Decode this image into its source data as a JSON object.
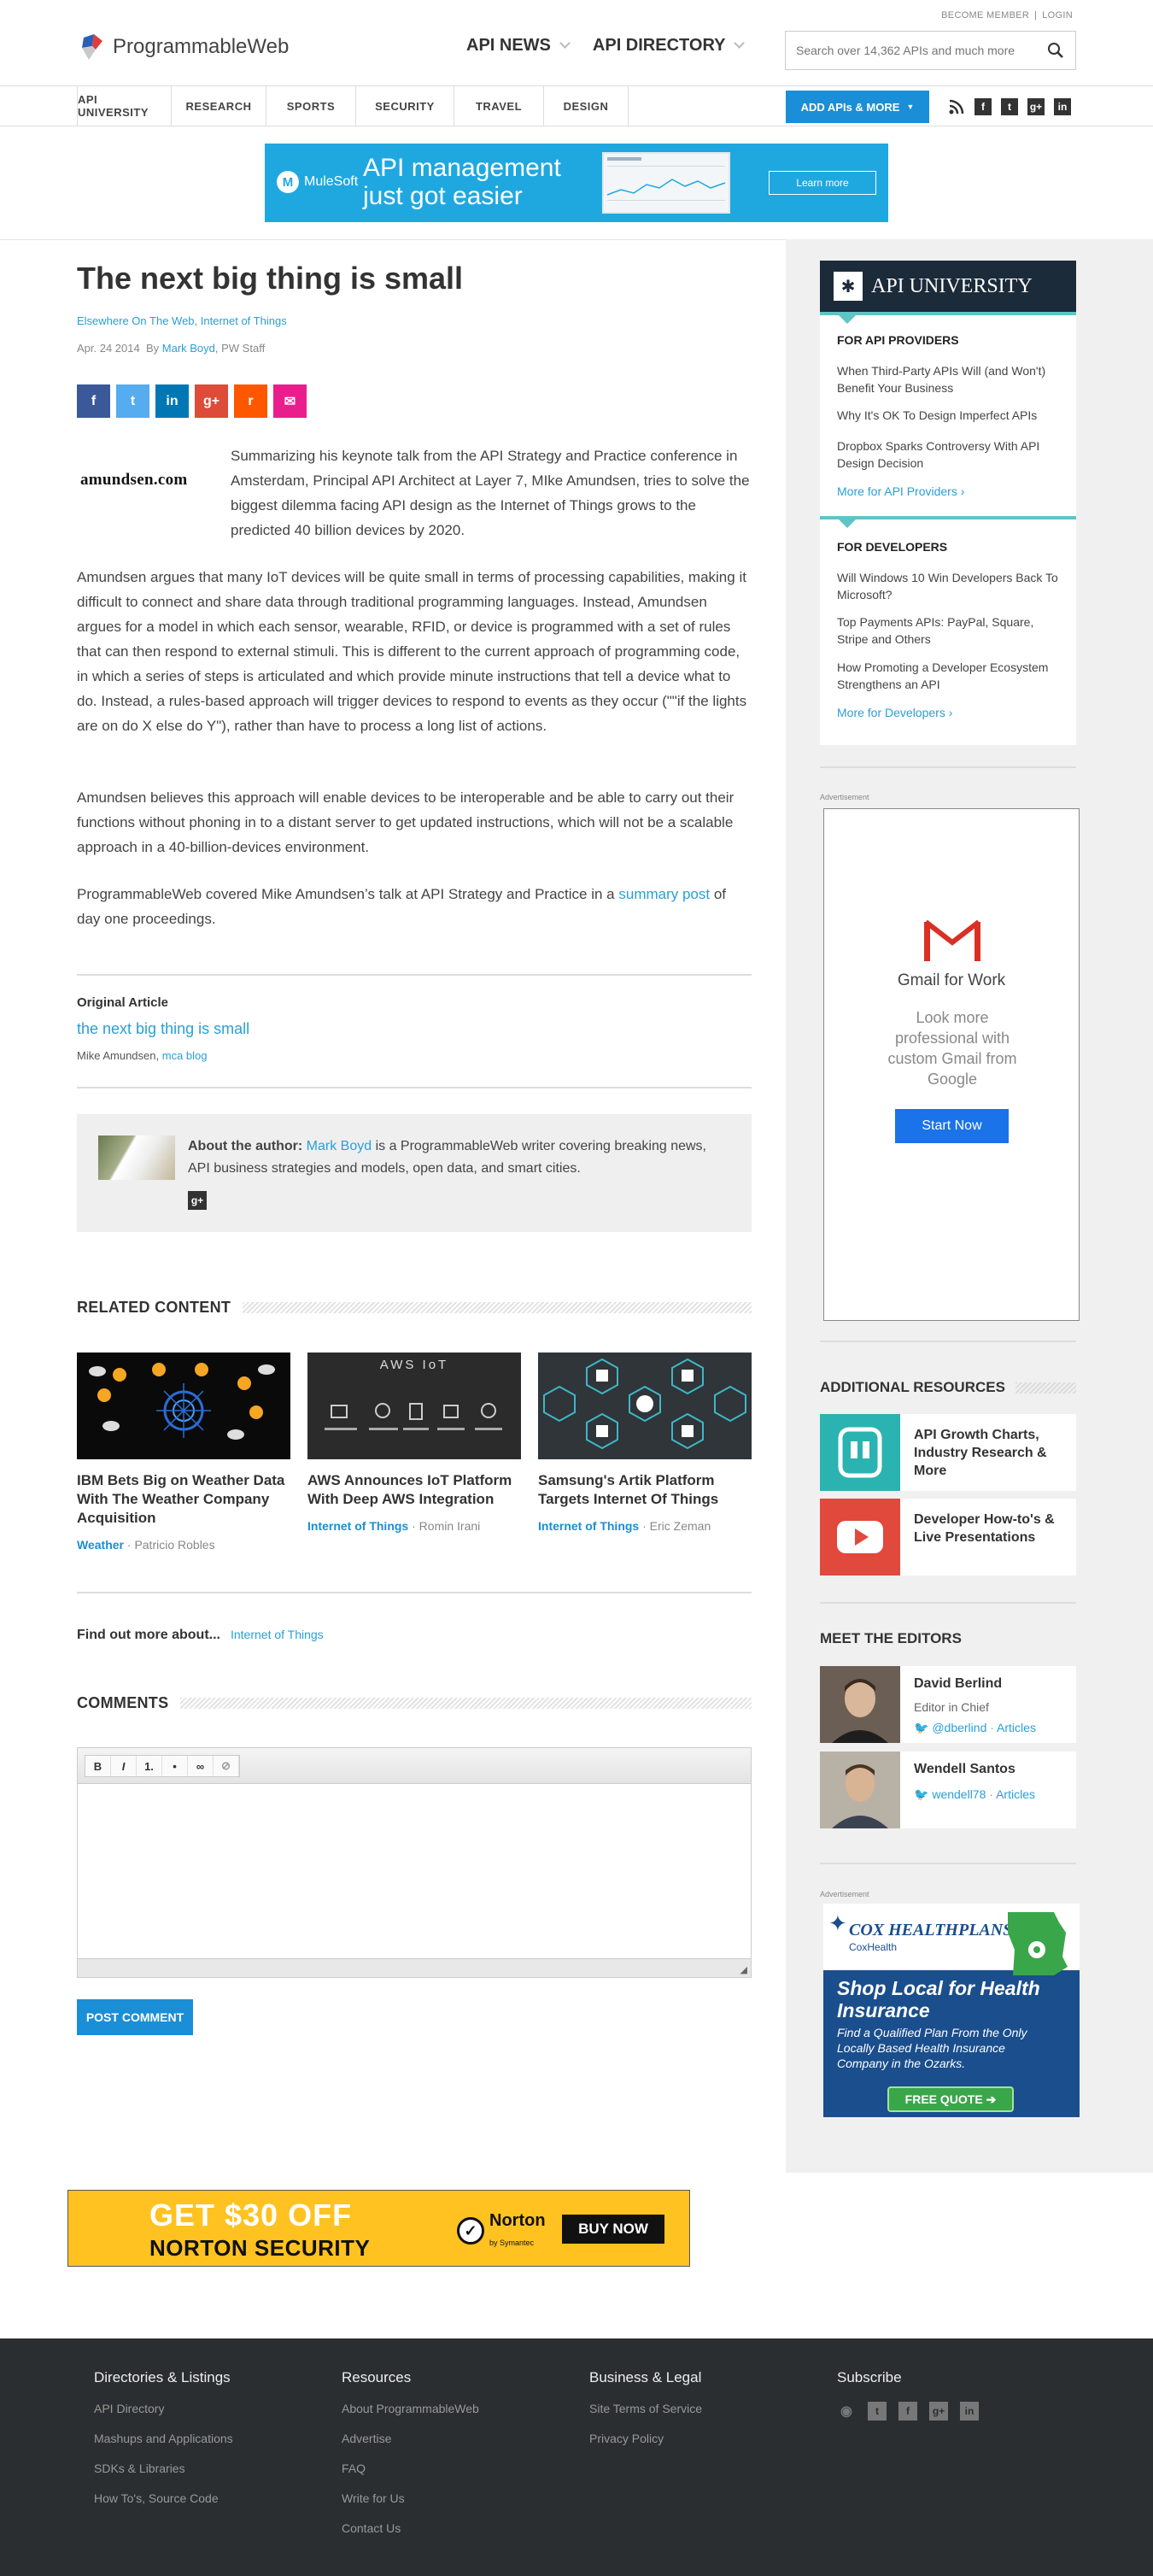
{
  "header": {
    "top_links": [
      "BECOME MEMBER",
      "LOGIN"
    ],
    "logo_text": "ProgrammableWeb",
    "nav": [
      "API NEWS",
      "API DIRECTORY"
    ],
    "search_placeholder": "Search over 14,362 APIs and much more",
    "subnav": [
      "API UNIVERSITY",
      "RESEARCH",
      "SPORTS",
      "SECURITY",
      "TRAVEL",
      "DESIGN"
    ],
    "add_button": "ADD APIs & MORE",
    "social_icons": [
      "rss-icon",
      "facebook-icon",
      "twitter-icon",
      "google-plus-icon",
      "linkedin-icon"
    ]
  },
  "banner": {
    "brand": "MuleSoft",
    "headline_1": "API management",
    "headline_2": "just got easier",
    "button": "Learn more"
  },
  "article": {
    "title": "The next big thing is small",
    "categories": "Elsewhere On The Web, Internet of Things",
    "date": "Apr. 24 2014",
    "by": "By",
    "author": "Mark Boyd",
    "author_role": ", PW Staff",
    "share_colors": [
      "#3b5998",
      "#55acee",
      "#0077b5",
      "#dd4b39",
      "#ff5700",
      "#e91e8c"
    ],
    "logo_text": "amundsen.com",
    "intro": "Summarizing his keynote talk from the API Strategy and Practice conference in Amsterdam, Principal API Architect at Layer 7, MIke Amundsen, tries to solve the biggest dilemma facing API design as the Internet of Things grows to the predicted 40 billion devices by 2020.",
    "p1": "Amundsen argues that many IoT devices will be quite small in terms of processing capabilities, making it difficult to connect and share data through traditional programming languages. Instead, Amundsen argues for a model in which each sensor, wearable, RFID, or device is programmed with a set of rules that can then respond to external stimuli. This is different to the current approach of programming code, in which a series of steps is articulated and which provide minute instructions that tell a device what to do. Instead, a rules-based approach will trigger devices to respond to events as they occur (\"\"if the lights are on do X else do Y\"), rather than have to process a long list of actions.",
    "p2": "Amundsen believes this approach will enable devices to be interoperable and be able to carry out their functions without phoning in to a distant server to get updated instructions, which will not be a scalable approach in a 40-billion-devices environment.",
    "p3_pre": "ProgrammableWeb covered Mike Amundsen’s talk at API Strategy and Practice in a ",
    "p3_link": "summary post",
    "p3_post": " of day one proceedings.",
    "original_heading": "Original Article",
    "original_title": "the next big thing is small",
    "original_author": "Mike Amundsen,",
    "original_source": "mca blog",
    "about_label": "About the author:",
    "about_author": "Mark Boyd",
    "about_text": " is a ProgrammableWeb writer covering breaking news, API business strategies and models, open data, and smart cities."
  },
  "related": {
    "heading": "RELATED CONTENT",
    "items": [
      {
        "title": "IBM Bets Big on Weather Data With The Weather Company Acquisition",
        "category": "Weather",
        "author": "Patricio Robles"
      },
      {
        "title": "AWS Announces IoT Platform With Deep AWS Integration",
        "category": "Internet of Things",
        "author": "Romin Irani",
        "image_label": "AWS IoT"
      },
      {
        "title": "Samsung's Artik Platform Targets Internet Of Things",
        "category": "Internet of Things",
        "author": "Eric Zeman"
      }
    ]
  },
  "findmore": {
    "label": "Find out more about...",
    "link": "Internet of Things"
  },
  "comments": {
    "heading": "COMMENTS",
    "tools": [
      "B",
      "I",
      "1.",
      "•",
      "∞",
      "⊘"
    ],
    "post_button": "POST COMMENT"
  },
  "sidebar": {
    "apiu_title": "API UNIVERSITY",
    "providers_heading": "FOR API PROVIDERS",
    "providers": [
      "When Third-Party APIs Will (and Won't) Benefit Your Business",
      "Why It's OK To Design Imperfect APIs",
      "Dropbox Sparks Controversy With API Design Decision"
    ],
    "providers_more": "More for API Providers ›",
    "developers_heading": "FOR DEVELOPERS",
    "developers": [
      "Will Windows 10 Win Developers Back To Microsoft?",
      "Top Payments APIs: PayPal, Square, Stripe and Others",
      "How Promoting a Developer Ecosystem Strengthens an API"
    ],
    "developers_more": "More for Developers ›",
    "advertisement": "Advertisement",
    "gmail_title": "Gmail for Work",
    "gmail_text": "Look more professional with custom Gmail from Google",
    "gmail_button": "Start Now",
    "resources_heading": "ADDITIONAL RESOURCES",
    "resources": [
      {
        "label": "API Growth Charts, Industry Research & More",
        "color": "#2ab3b0"
      },
      {
        "label": "Developer How-to's & Live Presentations",
        "color": "#e0493c"
      }
    ],
    "editors_heading": "MEET THE EDITORS",
    "editors": [
      {
        "name": "David Berlind",
        "role": "Editor in Chief",
        "twitter": "@dberlind",
        "articles": "Articles"
      },
      {
        "name": "Wendell Santos",
        "twitter": "wendell78",
        "articles": "Articles"
      }
    ],
    "cox_brand": "COX HEALTHPLANS",
    "cox_sub": "CoxHealth",
    "cox_headline": "Shop Local for Health Insurance",
    "cox_text": "Find a Qualified Plan From the Only Locally Based Health Insurance Company in the Ozarks.",
    "cox_button": "FREE QUOTE"
  },
  "norton": {
    "line1": "GET $30 OFF",
    "line2": "NORTON SECURITY",
    "brand": "Norton",
    "brand_sub": "by Symantec",
    "button": "BUY NOW"
  },
  "footer": {
    "columns": [
      {
        "heading": "Directories & Listings",
        "links": [
          "API Directory",
          "Mashups and Applications",
          "SDKs & Libraries",
          "How To's, Source Code"
        ]
      },
      {
        "heading": "Resources",
        "links": [
          "About ProgrammableWeb",
          "Advertise",
          "FAQ",
          "Write for Us",
          "Contact Us"
        ]
      },
      {
        "heading": "Business & Legal",
        "links": [
          "Site Terms of Service",
          "Privacy Policy"
        ]
      },
      {
        "heading": "Subscribe",
        "icons": [
          "rss-icon",
          "twitter-icon",
          "facebook-icon",
          "google-plus-icon",
          "linkedin-icon"
        ]
      }
    ]
  }
}
